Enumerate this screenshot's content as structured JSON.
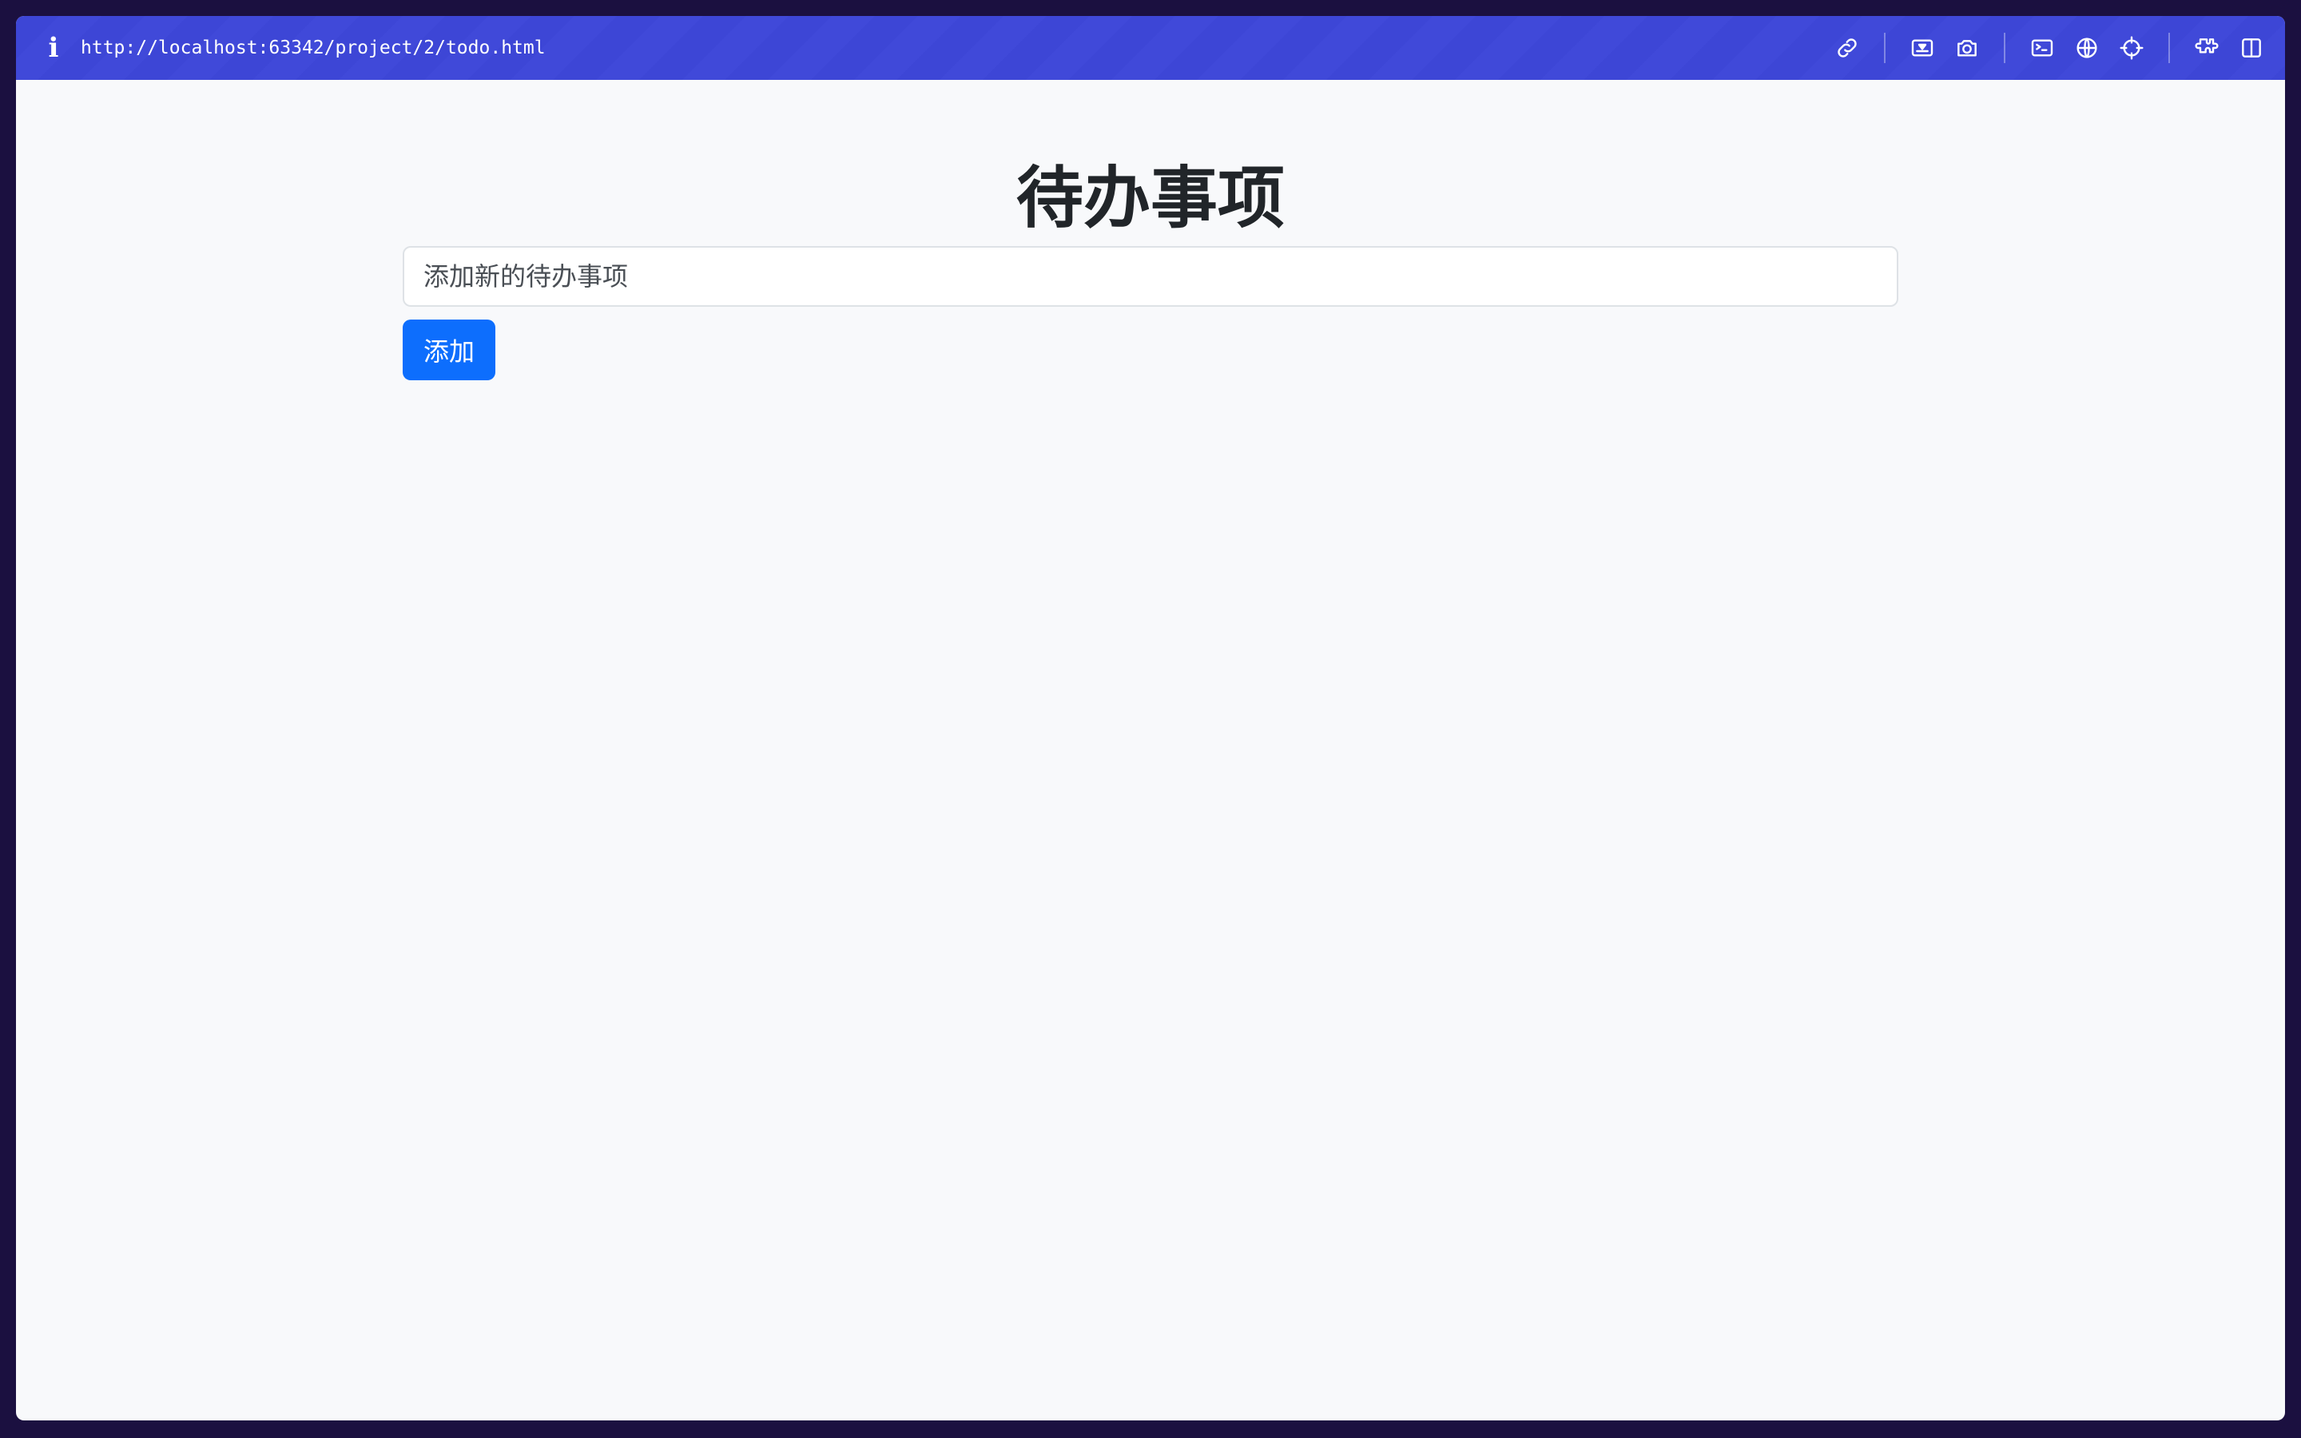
{
  "browser": {
    "info_icon": "info-icon",
    "url": "http://localhost:63342/project/2/todo.html",
    "toolbar_icons": [
      "link-icon",
      "screen-capture-icon",
      "camera-icon",
      "terminal-icon",
      "globe-icon",
      "crosshair-icon",
      "extensions-icon",
      "sidebar-toggle-icon"
    ],
    "accent_color": "#3d46d6"
  },
  "page": {
    "title": "待办事项",
    "input_placeholder": "添加新的待办事项",
    "input_value": "",
    "add_button_label": "添加",
    "button_color": "#0d6efd"
  }
}
